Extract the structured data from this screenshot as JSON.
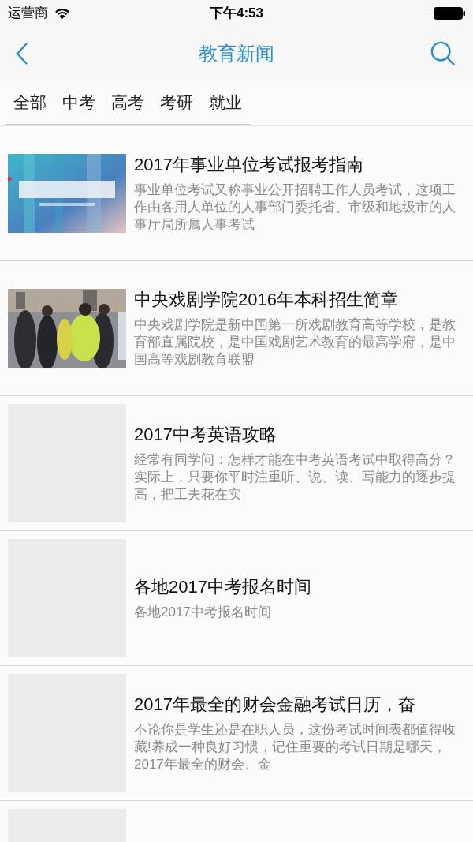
{
  "status_bar": {
    "carrier": "运营商",
    "time": "下午4:53"
  },
  "nav": {
    "title": "教育新闻"
  },
  "tabs": [
    {
      "label": "全部"
    },
    {
      "label": "中考"
    },
    {
      "label": "高考"
    },
    {
      "label": "考研"
    },
    {
      "label": "就业"
    }
  ],
  "articles": [
    {
      "kind": "banner",
      "title": "2017年事业单位考试报考指南",
      "summary": "事业单位考试又称事业公开招聘工作人员考试，这项工作由各用人单位的人事部门委托省、市级和地级市的人事厅局所属人事考试"
    },
    {
      "title": "中央戏剧学院2016年本科招生简章",
      "summary": "中央戏剧学院是新中国第一所戏剧教育高等学校，是教育部直属院校，是中国戏剧艺术教育的最高学府，是中国高等戏剧教育联盟"
    },
    {
      "kind": "placeholder",
      "title": "2017中考英语攻略",
      "summary": "经常有同学问：怎样才能在中考英语考试中取得高分？实际上，只要你平时注重听、说、读、写能力的逐步提高，把工夫花在实"
    },
    {
      "kind": "placeholder",
      "title": "各地2017中考报名时间",
      "summary": "各地2017中考报名时间"
    },
    {
      "kind": "placeholder",
      "title": "2017年最全的财会金融考试日历，奋",
      "summary": "不论你是学生还是在职人员，这份考试时间表都值得收藏!养成一种良好习惯，记住重要的考试日期是哪天，2017年最全的财会、金"
    },
    {
      "kind": "placeholder"
    }
  ]
}
